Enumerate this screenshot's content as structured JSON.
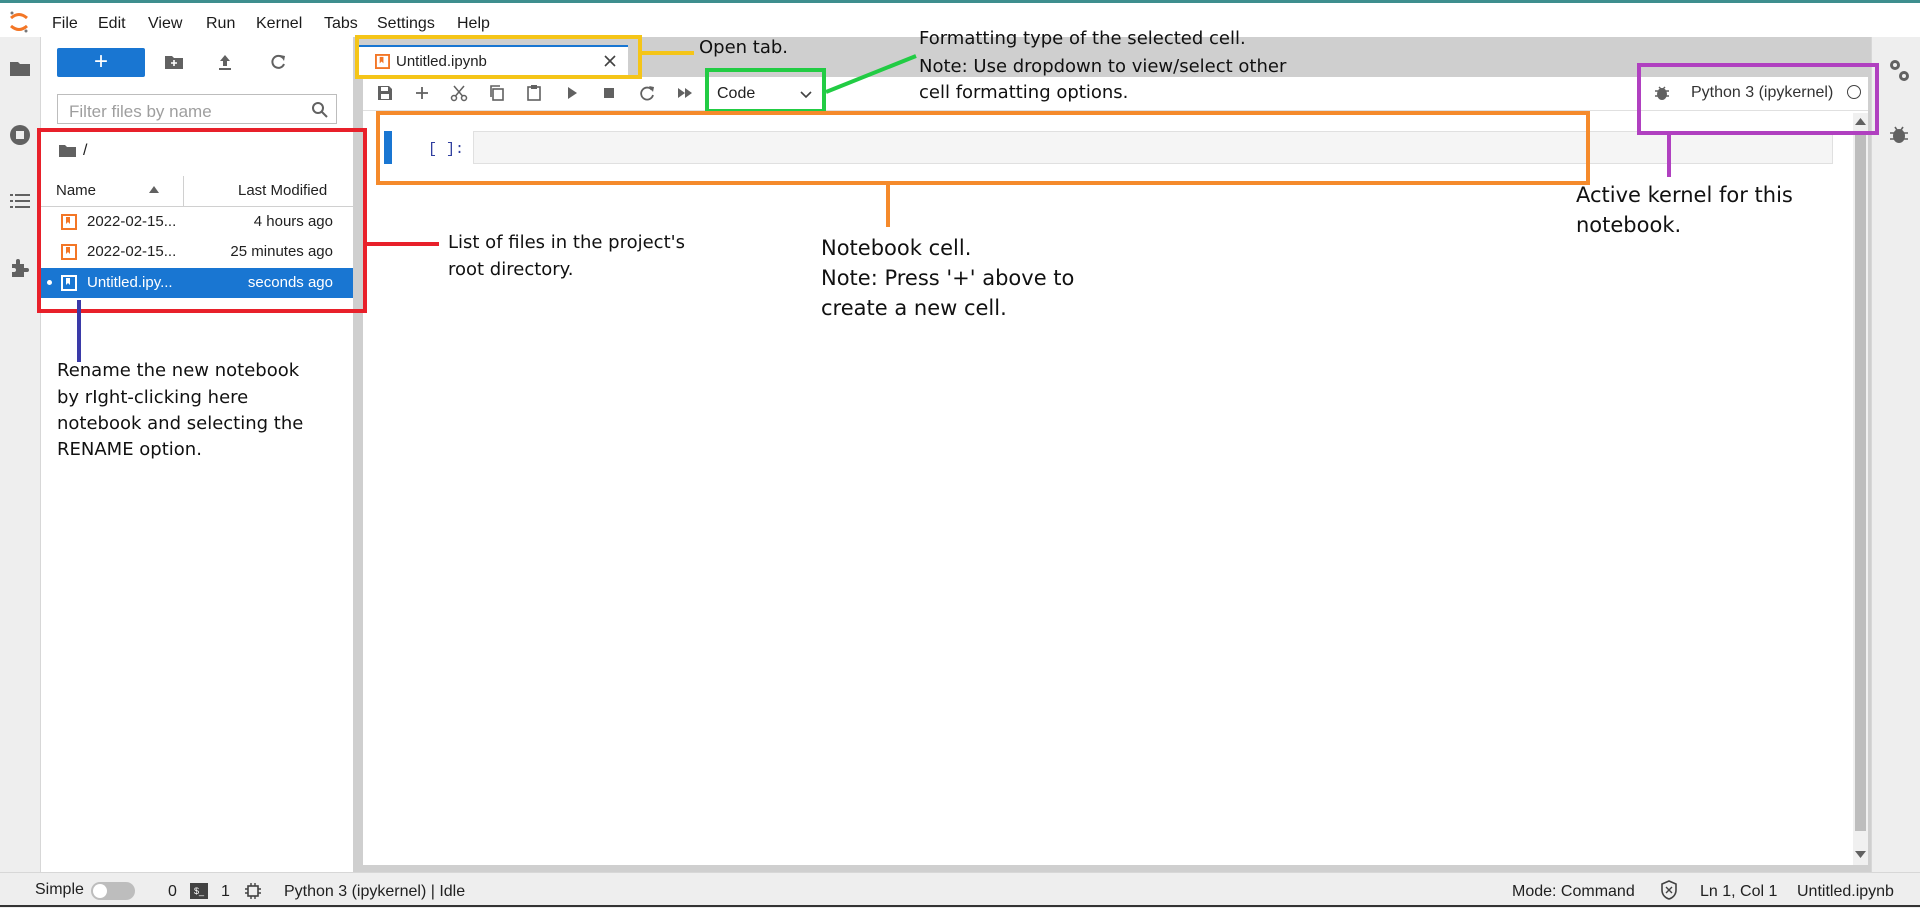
{
  "menu": [
    "File",
    "Edit",
    "View",
    "Run",
    "Kernel",
    "Tabs",
    "Settings",
    "Help"
  ],
  "file_browser": {
    "new_label": "+",
    "filter_placeholder": "Filter files by name",
    "breadcrumb": "/",
    "columns": {
      "name": "Name",
      "modified": "Last Modified"
    },
    "files": [
      {
        "name": "2022-02-15...",
        "modified": "4 hours ago"
      },
      {
        "name": "2022-02-15...",
        "modified": "25 minutes ago"
      },
      {
        "name": "Untitled.ipy...",
        "modified": "seconds ago"
      }
    ]
  },
  "tab": {
    "label": "Untitled.ipynb"
  },
  "notebook": {
    "cell_type": "Code",
    "kernel": "Python 3 (ipykernel)",
    "prompt": "[ ]:"
  },
  "statusbar": {
    "simple": "Simple",
    "terminals_count": "0",
    "kernels_count": "1",
    "kernel_status": "Python 3 (ipykernel) | Idle",
    "mode": "Mode: Command",
    "position": "Ln 1, Col 1",
    "filename": "Untitled.ipynb"
  },
  "annotations": {
    "open_tab": "Open tab.",
    "formatting_1": "Formatting type of the selected cell.",
    "formatting_2": "Note: Use dropdown to view/select other",
    "formatting_3": "cell formatting options.",
    "files_1": "List of files in the project's",
    "files_2": "root directory.",
    "rename_1": "Rename the new notebook",
    "rename_2": "by rIght-clicking here",
    "rename_3": "notebook and selecting the",
    "rename_4": "RENAME option.",
    "cell_1": "Notebook cell.",
    "cell_2": "Note: Press '+' above to",
    "cell_3": "create a new cell.",
    "kernel_1": "Active kernel for this",
    "kernel_2": "notebook."
  },
  "colors": {
    "accent": "#1976d2",
    "ann_tab": "#f5c518",
    "ann_files": "#e8202a",
    "ann_type": "#22cc44",
    "ann_cell": "#f58a2b",
    "ann_kernel": "#b040c0",
    "ann_rename": "#3a3aa8"
  }
}
